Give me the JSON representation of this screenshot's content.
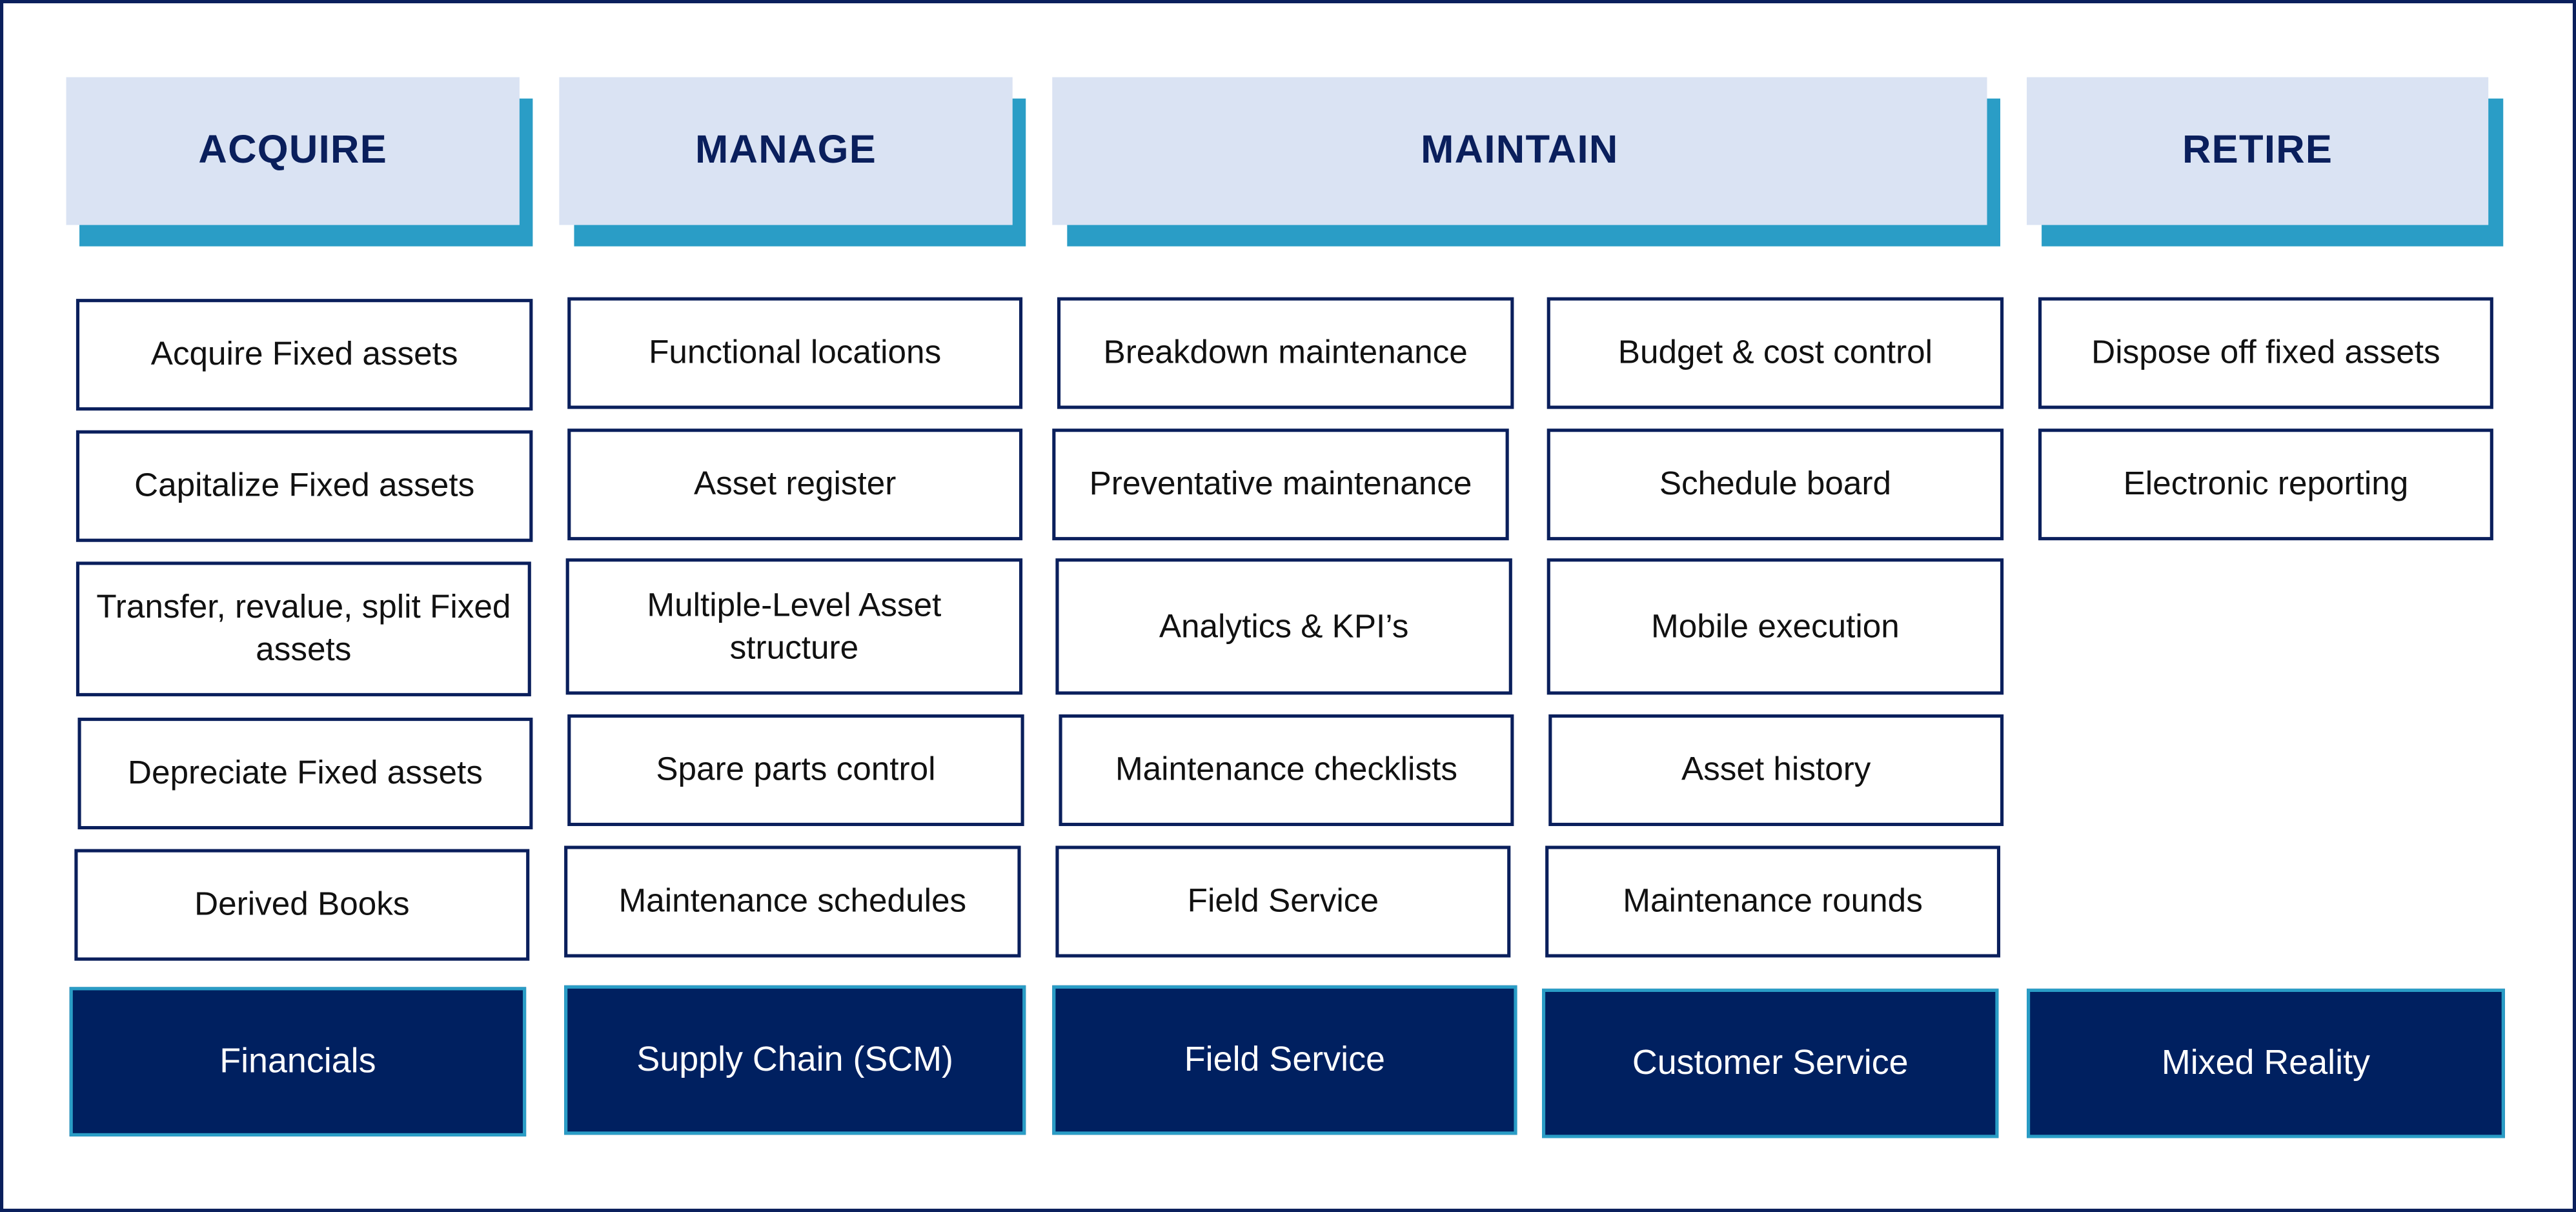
{
  "colors": {
    "frame_border": "#0a1f5c",
    "header_fill": "#dae3f3",
    "header_shadow": "#2a9dc6",
    "header_text": "#0a1f5c",
    "card_border": "#0a1f5c",
    "platform_fill": "#002060",
    "platform_border": "#2a9dc6"
  },
  "phases": [
    {
      "label": "ACQUIRE"
    },
    {
      "label": "MANAGE"
    },
    {
      "label": "MAINTAIN"
    },
    {
      "label": "RETIRE"
    }
  ],
  "columns": [
    {
      "phase": "ACQUIRE",
      "items": [
        "Acquire Fixed assets",
        "Capitalize Fixed assets",
        "Transfer, revalue, split Fixed assets",
        "Depreciate Fixed assets",
        "Derived Books"
      ]
    },
    {
      "phase": "MANAGE",
      "items": [
        "Functional locations",
        "Asset register",
        "Multiple-Level Asset structure",
        "Spare parts control",
        "Maintenance schedules"
      ]
    },
    {
      "phase": "MAINTAIN",
      "items": [
        "Breakdown maintenance",
        "Preventative maintenance",
        "Analytics & KPI’s",
        "Maintenance checklists",
        "Field Service"
      ]
    },
    {
      "phase": "MAINTAIN",
      "items": [
        "Budget & cost control",
        "Schedule board",
        "Mobile execution",
        "Asset history",
        "Maintenance rounds"
      ]
    },
    {
      "phase": "RETIRE",
      "items": [
        "Dispose off fixed assets",
        "Electronic reporting"
      ]
    }
  ],
  "platforms": [
    "Financials",
    "Supply Chain (SCM)",
    "Field Service",
    "Customer Service",
    "Mixed Reality"
  ]
}
